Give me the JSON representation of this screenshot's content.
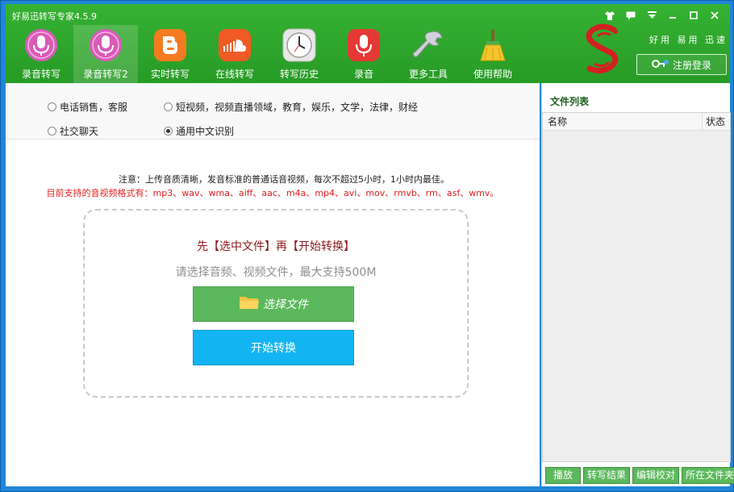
{
  "window": {
    "title": "好易迅转写专家4.5.9"
  },
  "toolbar": {
    "items": [
      {
        "label": "录音转写",
        "icon": "microphone-pink-icon"
      },
      {
        "label": "录音转写2",
        "icon": "microphone-pink-icon"
      },
      {
        "label": "实时转写",
        "icon": "blogger-orange-icon"
      },
      {
        "label": "在线转写",
        "icon": "soundcloud-cloud-icon"
      },
      {
        "label": "转写历史",
        "icon": "clock-icon"
      },
      {
        "label": "录音",
        "icon": "microphone-red-icon"
      },
      {
        "label": "更多工具",
        "icon": "wrench-icon"
      },
      {
        "label": "使用帮助",
        "icon": "broom-icon"
      }
    ],
    "active_index": 1
  },
  "brand": {
    "slogan": "好用 易用 迅速",
    "login_label": "注册登录"
  },
  "options": {
    "opt1": "电话销售，客服",
    "opt2": "短视频，视频直播领域，教育，娱乐，文学，法律，财经",
    "opt3": "社交聊天",
    "opt4": "通用中文识别",
    "selected": "opt4"
  },
  "notes": {
    "line1": "注意：上传音质清晰，发音标准的普通话音视频，每次不超过5小时，1小时内最佳。",
    "line2": "目前支持的音视频格式有：mp3、wav、wma、aiff、aac、m4a、mp4、avi、mov、rmvb、rm、asf、wmv。"
  },
  "dropzone": {
    "title": "先【选中文件】再【开始转换】",
    "subtitle": "请选择音频、视频文件，最大支持500M",
    "select_label": "选择文件",
    "start_label": "开始转换"
  },
  "file_list": {
    "title": "文件列表",
    "col_name": "名称",
    "col_status": "状态",
    "buttons": [
      "播放",
      "转写结果",
      "编辑校对",
      "所在文件夹"
    ]
  },
  "colors": {
    "header_green": "#2ea52c",
    "select_button": "#5cb85c",
    "start_button": "#12b5f2",
    "notice_red": "#e11d1d"
  }
}
